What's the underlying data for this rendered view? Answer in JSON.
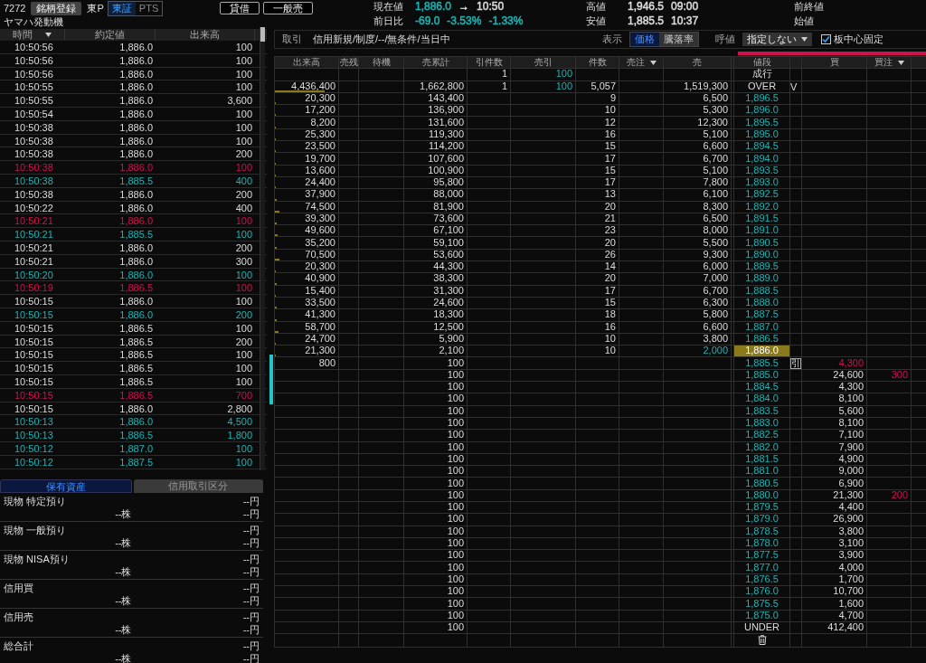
{
  "symbol": {
    "code": "7272",
    "register_button": "銘柄登録",
    "market": "東P",
    "exchanges": [
      {
        "label": "東証",
        "selected": true
      },
      {
        "label": "PTS",
        "selected": false
      }
    ],
    "name": "ヤマハ発動機"
  },
  "actions": [
    "貸借",
    "一般売"
  ],
  "quote_columns": [
    [
      {
        "label": "現在値",
        "values": [
          {
            "text": "1,886.0",
            "color": "#1ab5b5"
          },
          {
            "text": "→"
          },
          {
            "text": "10:50",
            "color": "#dddddd"
          }
        ]
      },
      {
        "label": "前日比",
        "values": [
          {
            "text": "-69.0",
            "color": "#1ab5b5"
          },
          {
            "text": "-3.53%",
            "color": "#1ab5b5"
          },
          {
            "text": "-1.33%",
            "color": "#1ab5b5"
          }
        ]
      }
    ],
    [
      {
        "label": "高値",
        "values": [
          {
            "text": "1,946.5",
            "color": "#dddddd"
          },
          {
            "text": "09:00",
            "color": "#dddddd"
          }
        ]
      },
      {
        "label": "安値",
        "values": [
          {
            "text": "1,885.5",
            "color": "#dddddd"
          },
          {
            "text": "10:37",
            "color": "#dddddd"
          }
        ]
      }
    ],
    [
      {
        "label": "前終値"
      },
      {
        "label": "始値"
      }
    ]
  ],
  "trades": {
    "columns": [
      {
        "label": "時間",
        "sort": true
      },
      {
        "label": "約定値",
        "sort": false
      },
      {
        "label": "出来高",
        "sort": false
      }
    ],
    "rows": [
      {
        "time": "10:50:56",
        "price": "1,886.0",
        "volume": "100",
        "color": "#dddddd"
      },
      {
        "time": "10:50:56",
        "price": "1,886.0",
        "volume": "100",
        "color": "#dddddd"
      },
      {
        "time": "10:50:56",
        "price": "1,886.0",
        "volume": "100",
        "color": "#dddddd"
      },
      {
        "time": "10:50:55",
        "price": "1,886.0",
        "volume": "100",
        "color": "#dddddd"
      },
      {
        "time": "10:50:55",
        "price": "1,886.0",
        "volume": "3,600",
        "color": "#dddddd"
      },
      {
        "time": "10:50:54",
        "price": "1,886.0",
        "volume": "100",
        "color": "#dddddd"
      },
      {
        "time": "10:50:38",
        "price": "1,886.0",
        "volume": "100",
        "color": "#dddddd"
      },
      {
        "time": "10:50:38",
        "price": "1,886.0",
        "volume": "100",
        "color": "#dddddd"
      },
      {
        "time": "10:50:38",
        "price": "1,886.0",
        "volume": "200",
        "color": "#dddddd"
      },
      {
        "time": "10:50:38",
        "price": "1,886.0",
        "volume": "100",
        "color": "#d3104e"
      },
      {
        "time": "10:50:38",
        "price": "1,885.5",
        "volume": "400",
        "color": "#1ab5b5"
      },
      {
        "time": "10:50:38",
        "price": "1,886.0",
        "volume": "200",
        "color": "#dddddd"
      },
      {
        "time": "10:50:22",
        "price": "1,886.0",
        "volume": "400",
        "color": "#dddddd"
      },
      {
        "time": "10:50:21",
        "price": "1,886.0",
        "volume": "100",
        "color": "#d3104e"
      },
      {
        "time": "10:50:21",
        "price": "1,885.5",
        "volume": "100",
        "color": "#1ab5b5"
      },
      {
        "time": "10:50:21",
        "price": "1,886.0",
        "volume": "200",
        "color": "#dddddd"
      },
      {
        "time": "10:50:21",
        "price": "1,886.0",
        "volume": "300",
        "color": "#dddddd"
      },
      {
        "time": "10:50:20",
        "price": "1,886.0",
        "volume": "100",
        "color": "#1ab5b5"
      },
      {
        "time": "10:50:19",
        "price": "1,886.5",
        "volume": "100",
        "color": "#d3104e"
      },
      {
        "time": "10:50:15",
        "price": "1,886.0",
        "volume": "100",
        "color": "#dddddd"
      },
      {
        "time": "10:50:15",
        "price": "1,886.0",
        "volume": "200",
        "color": "#1ab5b5"
      },
      {
        "time": "10:50:15",
        "price": "1,886.5",
        "volume": "100",
        "color": "#dddddd"
      },
      {
        "time": "10:50:15",
        "price": "1,886.5",
        "volume": "200",
        "color": "#dddddd"
      },
      {
        "time": "10:50:15",
        "price": "1,886.5",
        "volume": "100",
        "color": "#dddddd"
      },
      {
        "time": "10:50:15",
        "price": "1,886.5",
        "volume": "100",
        "color": "#dddddd"
      },
      {
        "time": "10:50:15",
        "price": "1,886.5",
        "volume": "100",
        "color": "#dddddd"
      },
      {
        "time": "10:50:15",
        "price": "1,886.5",
        "volume": "700",
        "color": "#d3104e"
      },
      {
        "time": "10:50:15",
        "price": "1,886.0",
        "volume": "2,800",
        "color": "#dddddd"
      },
      {
        "time": "10:50:13",
        "price": "1,886.0",
        "volume": "4,500",
        "color": "#1ab5b5"
      },
      {
        "time": "10:50:13",
        "price": "1,886.5",
        "volume": "1,800",
        "color": "#1ab5b5"
      },
      {
        "time": "10:50:12",
        "price": "1,887.0",
        "volume": "100",
        "color": "#1ab5b5"
      },
      {
        "time": "10:50:12",
        "price": "1,887.5",
        "volume": "100",
        "color": "#1ab5b5"
      }
    ]
  },
  "holdings": {
    "tabs": [
      {
        "label": "保有資産",
        "selected": true
      },
      {
        "label": "信用取引区分",
        "selected": false
      }
    ],
    "items": [
      {
        "label": "現物 特定預り",
        "amount": "--円",
        "shares": "--株",
        "value": "--円"
      },
      {
        "label": "現物 一般預り",
        "amount": "--円",
        "shares": "--株",
        "value": "--円"
      },
      {
        "label": "現物 NISA預り",
        "amount": "--円",
        "shares": "--株",
        "value": "--円"
      },
      {
        "label": "信用買",
        "amount": "--円",
        "shares": "--株",
        "value": "--円"
      },
      {
        "label": "信用売",
        "amount": "--円",
        "shares": "--株",
        "value": "--円"
      },
      {
        "label": "総合計",
        "amount": "--円",
        "shares": "--株",
        "value": "--円"
      }
    ]
  },
  "toolbar": {
    "trade_label": "取引",
    "trade_value": "信用新規/制度/--/無条件/当日中",
    "display_label": "表示",
    "display_options": [
      {
        "label": "価格",
        "selected": true
      },
      {
        "label": "騰落率",
        "selected": false
      }
    ],
    "tick_label": "呼値",
    "tick_select": "指定しない",
    "center_fixed": {
      "label": "板中心固定",
      "checked": true
    }
  },
  "board": {
    "columns": [
      {
        "label": "出来高",
        "sort": false
      },
      {
        "label": "売残",
        "sort": false
      },
      {
        "label": "待機",
        "sort": false
      },
      {
        "label": "売累計",
        "sort": false
      },
      {
        "label": "引件数",
        "sort": false
      },
      {
        "label": "売引",
        "sort": false
      },
      {
        "label": "件数",
        "sort": false
      },
      {
        "label": "売注",
        "sort": true
      },
      {
        "label": "売",
        "sort": false
      },
      {
        "label": "値段",
        "sort": false
      },
      {
        "label": "買",
        "sort": false
      },
      {
        "label": "買注",
        "sort": true
      }
    ],
    "rows": [
      {
        "kind": "market",
        "pull_count": "1",
        "sell_pull": "100",
        "price": "成行"
      },
      {
        "kind": "over",
        "volume": "4,436,400",
        "level": 0.78,
        "sell_cum": "1,662,800",
        "pull_count": "1",
        "sell_pull": "100",
        "count": "5,057",
        "sell": "1,519,300",
        "price": "OVER",
        "flag": "V"
      },
      {
        "kind": "ask",
        "volume": "20,300",
        "level": 0.02,
        "sell_cum": "143,400",
        "count": "9",
        "sell": "6,500",
        "price": "1,896.5"
      },
      {
        "kind": "ask",
        "volume": "17,200",
        "level": 0.02,
        "sell_cum": "136,900",
        "count": "10",
        "sell": "5,300",
        "price": "1,896.0"
      },
      {
        "kind": "ask",
        "volume": "8,200",
        "level": 0.01,
        "sell_cum": "131,600",
        "count": "12",
        "sell": "12,300",
        "price": "1,895.5"
      },
      {
        "kind": "ask",
        "volume": "25,300",
        "level": 0.02,
        "sell_cum": "119,300",
        "count": "16",
        "sell": "5,100",
        "price": "1,895.0"
      },
      {
        "kind": "ask",
        "volume": "23,500",
        "level": 0.02,
        "sell_cum": "114,200",
        "count": "15",
        "sell": "6,600",
        "price": "1,894.5"
      },
      {
        "kind": "ask",
        "volume": "19,700",
        "level": 0.02,
        "sell_cum": "107,600",
        "count": "17",
        "sell": "6,700",
        "price": "1,894.0"
      },
      {
        "kind": "ask",
        "volume": "13,600",
        "level": 0.01,
        "sell_cum": "100,900",
        "count": "15",
        "sell": "5,100",
        "price": "1,893.5"
      },
      {
        "kind": "ask",
        "volume": "24,400",
        "level": 0.02,
        "sell_cum": "95,800",
        "count": "17",
        "sell": "7,800",
        "price": "1,893.0"
      },
      {
        "kind": "ask",
        "volume": "37,900",
        "level": 0.03,
        "sell_cum": "88,000",
        "count": "13",
        "sell": "6,100",
        "price": "1,892.5"
      },
      {
        "kind": "ask",
        "volume": "74,500",
        "level": 0.07,
        "sell_cum": "81,900",
        "count": "20",
        "sell": "8,300",
        "price": "1,892.0"
      },
      {
        "kind": "ask",
        "volume": "39,300",
        "level": 0.03,
        "sell_cum": "73,600",
        "count": "21",
        "sell": "6,500",
        "price": "1,891.5"
      },
      {
        "kind": "ask",
        "volume": "49,600",
        "level": 0.04,
        "sell_cum": "67,100",
        "count": "23",
        "sell": "8,000",
        "price": "1,891.0"
      },
      {
        "kind": "ask",
        "volume": "35,200",
        "level": 0.03,
        "sell_cum": "59,100",
        "count": "20",
        "sell": "5,500",
        "price": "1,890.5"
      },
      {
        "kind": "ask",
        "volume": "70,500",
        "level": 0.07,
        "sell_cum": "53,600",
        "count": "26",
        "sell": "9,300",
        "price": "1,890.0"
      },
      {
        "kind": "ask",
        "volume": "20,300",
        "level": 0.02,
        "sell_cum": "44,300",
        "count": "14",
        "sell": "6,000",
        "price": "1,889.5"
      },
      {
        "kind": "ask",
        "volume": "40,900",
        "level": 0.03,
        "sell_cum": "38,300",
        "count": "20",
        "sell": "7,000",
        "price": "1,889.0"
      },
      {
        "kind": "ask",
        "volume": "15,400",
        "level": 0.01,
        "sell_cum": "31,300",
        "count": "17",
        "sell": "6,700",
        "price": "1,888.5"
      },
      {
        "kind": "ask",
        "volume": "33,500",
        "level": 0.03,
        "sell_cum": "24,600",
        "count": "15",
        "sell": "6,300",
        "price": "1,888.0"
      },
      {
        "kind": "ask",
        "volume": "41,300",
        "level": 0.03,
        "sell_cum": "18,300",
        "count": "18",
        "sell": "5,800",
        "price": "1,887.5"
      },
      {
        "kind": "ask",
        "volume": "58,700",
        "level": 0.05,
        "sell_cum": "12,500",
        "count": "16",
        "sell": "6,600",
        "price": "1,887.0"
      },
      {
        "kind": "ask",
        "volume": "24,700",
        "level": 0.02,
        "sell_cum": "5,900",
        "count": "10",
        "sell": "3,800",
        "price": "1,886.5"
      },
      {
        "kind": "current",
        "volume": "21,300",
        "level": 0.02,
        "sell_cum": "2,100",
        "count": "10",
        "sell": "2,000",
        "price": "1,886.0"
      },
      {
        "kind": "best_bid",
        "volume": "800",
        "sell_cum": "100",
        "price": "1,885.5",
        "flag": "引",
        "buy": "4,300"
      },
      {
        "kind": "bid",
        "sell_cum": "100",
        "price": "1,885.0",
        "buy": "24,600",
        "buy_order": "300"
      },
      {
        "kind": "bid",
        "sell_cum": "100",
        "price": "1,884.5",
        "buy": "4,300"
      },
      {
        "kind": "bid",
        "sell_cum": "100",
        "price": "1,884.0",
        "buy": "8,100"
      },
      {
        "kind": "bid",
        "sell_cum": "100",
        "price": "1,883.5",
        "buy": "5,600"
      },
      {
        "kind": "bid",
        "sell_cum": "100",
        "price": "1,883.0",
        "buy": "8,100"
      },
      {
        "kind": "bid",
        "sell_cum": "100",
        "price": "1,882.5",
        "buy": "7,100"
      },
      {
        "kind": "bid",
        "sell_cum": "100",
        "price": "1,882.0",
        "buy": "7,900"
      },
      {
        "kind": "bid",
        "sell_cum": "100",
        "price": "1,881.5",
        "buy": "4,900"
      },
      {
        "kind": "bid",
        "sell_cum": "100",
        "price": "1,881.0",
        "buy": "9,000"
      },
      {
        "kind": "bid",
        "sell_cum": "100",
        "price": "1,880.5",
        "buy": "6,900"
      },
      {
        "kind": "bid",
        "sell_cum": "100",
        "price": "1,880.0",
        "buy": "21,300",
        "buy_order": "200"
      },
      {
        "kind": "bid",
        "sell_cum": "100",
        "price": "1,879.5",
        "buy": "4,400"
      },
      {
        "kind": "bid",
        "sell_cum": "100",
        "price": "1,879.0",
        "buy": "26,900"
      },
      {
        "kind": "bid",
        "sell_cum": "100",
        "price": "1,878.5",
        "buy": "3,800"
      },
      {
        "kind": "bid",
        "sell_cum": "100",
        "price": "1,878.0",
        "buy": "3,100"
      },
      {
        "kind": "bid",
        "sell_cum": "100",
        "price": "1,877.5",
        "buy": "3,900"
      },
      {
        "kind": "bid",
        "sell_cum": "100",
        "price": "1,877.0",
        "buy": "4,000"
      },
      {
        "kind": "bid",
        "sell_cum": "100",
        "price": "1,876.5",
        "buy": "1,700"
      },
      {
        "kind": "bid",
        "sell_cum": "100",
        "price": "1,876.0",
        "buy": "10,700"
      },
      {
        "kind": "bid",
        "sell_cum": "100",
        "price": "1,875.5",
        "buy": "1,600"
      },
      {
        "kind": "bid",
        "sell_cum": "100",
        "price": "1,875.0",
        "buy": "4,700"
      },
      {
        "kind": "under",
        "sell_cum": "100",
        "price": "UNDER",
        "buy": "412,400"
      },
      {
        "kind": "footer"
      }
    ]
  }
}
